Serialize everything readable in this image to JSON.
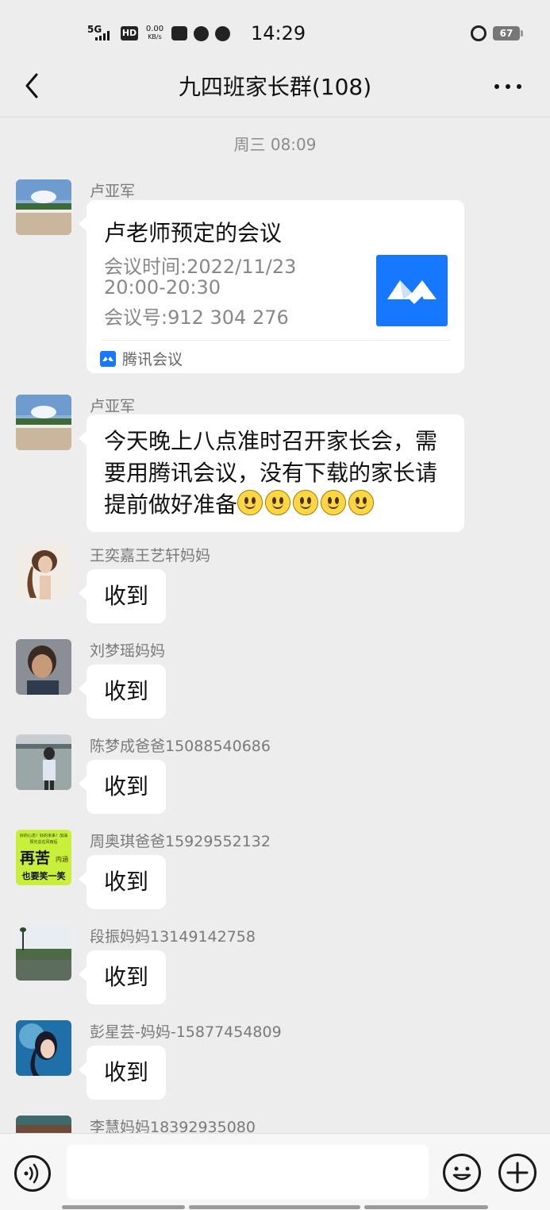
{
  "status_bar": {
    "network": "5G",
    "hd": "HD",
    "speed_value": "0.00",
    "speed_unit": "KB/s",
    "time": "14:29",
    "battery": "67"
  },
  "header": {
    "title": "九四班家长群(108)"
  },
  "time_separator": "周三 08:09",
  "meeting_card": {
    "sender": "卢亚军",
    "title": "卢老师预定的会议",
    "time_line": "会议时间:2022/11/23",
    "time_range": "20:00-20:30",
    "meeting_id": "会议号:912 304 276",
    "source": "腾讯会议"
  },
  "messages": [
    {
      "sender": "卢亚军",
      "text": "今天晚上八点准时召开家长会，需要用腾讯会议，没有下载的家长请提前做好准备"
    },
    {
      "sender": "王奕嘉王艺轩妈妈",
      "text": "收到"
    },
    {
      "sender": "刘梦瑶妈妈",
      "text": "收到"
    },
    {
      "sender": "陈梦成爸爸15088540686",
      "text": "收到"
    },
    {
      "sender": "周奥琪爸爸15929552132",
      "text": "收到"
    },
    {
      "sender": "段振妈妈13149142758",
      "text": "收到"
    },
    {
      "sender": "彭星芸-妈妈-15877454809",
      "text": "收到"
    },
    {
      "sender": "李慧妈妈18392935080"
    }
  ],
  "avatar_poster_text": {
    "line1": "好的心态！好的未来！加油",
    "line2": "阳光总在风雨后",
    "big": "再苦",
    "big2": "也要笑一笑",
    "side": "内涵"
  },
  "icons": {
    "back": "back-arrow-icon",
    "more": "more-dots-icon",
    "voice": "voice-icon",
    "emoji": "emoji-icon",
    "plus": "plus-icon",
    "tencent_meeting": "tencent-meeting-logo-icon"
  },
  "colors": {
    "background": "#ededed",
    "bubble": "#ffffff",
    "meeting_blue": "#1677ff"
  }
}
